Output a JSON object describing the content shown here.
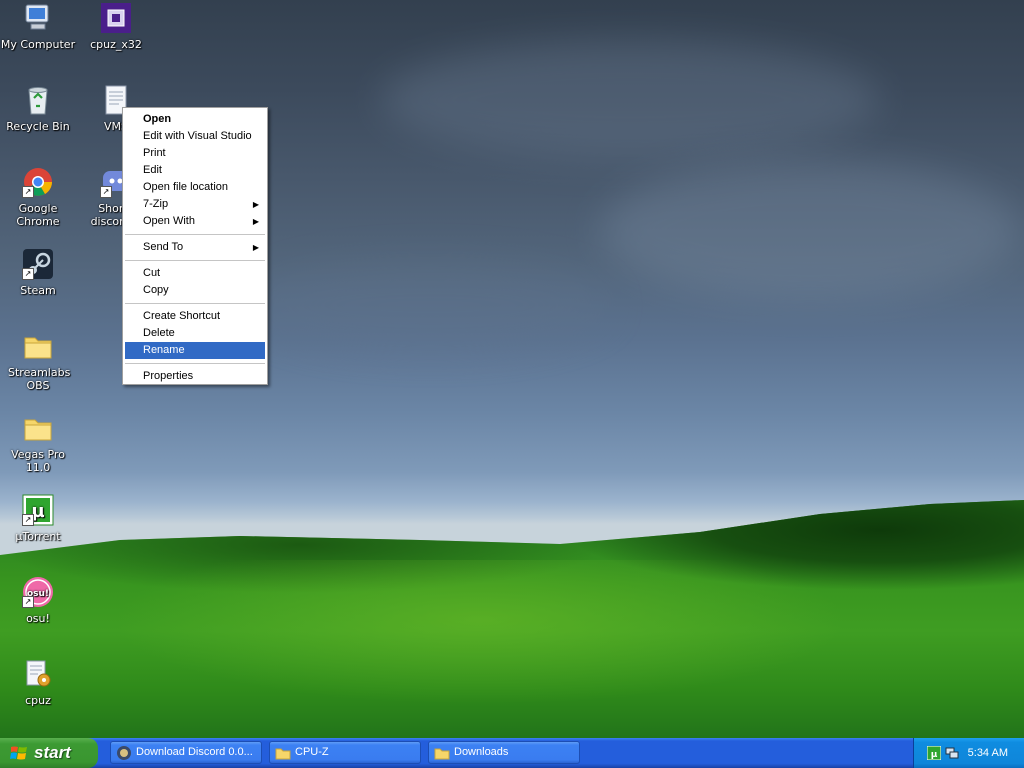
{
  "desktop": {
    "icons": [
      {
        "label": "My Computer"
      },
      {
        "label": "cpuz_x32"
      },
      {
        "label": "Recycle Bin"
      },
      {
        "label": "VMS"
      },
      {
        "label": "Google Chrome"
      },
      {
        "label": "Shortc discord-0"
      },
      {
        "label": "Steam"
      },
      {
        "label": "Streamlabs OBS"
      },
      {
        "label": "Vegas Pro 11.0"
      },
      {
        "label": "µTorrent"
      },
      {
        "label": "osu!"
      },
      {
        "label": "cpuz"
      }
    ]
  },
  "context_menu": {
    "items": [
      {
        "label": "Open"
      },
      {
        "label": "Edit with Visual Studio"
      },
      {
        "label": "Print"
      },
      {
        "label": "Edit"
      },
      {
        "label": "Open file location"
      },
      {
        "label": "7-Zip"
      },
      {
        "label": "Open With"
      },
      {
        "label": "Send To"
      },
      {
        "label": "Cut"
      },
      {
        "label": "Copy"
      },
      {
        "label": "Create Shortcut"
      },
      {
        "label": "Delete"
      },
      {
        "label": "Rename"
      },
      {
        "label": "Properties"
      }
    ],
    "highlighted": "Rename",
    "highlight_color": "#316ac5"
  },
  "taskbar": {
    "start_label": "start",
    "buttons": [
      {
        "label": "Download Discord 0.0..."
      },
      {
        "label": "CPU-Z"
      },
      {
        "label": "Downloads"
      }
    ],
    "clock": "5:34 AM",
    "tray_icons": [
      "utorrent-tray-icon",
      "network-tray-icon"
    ]
  }
}
